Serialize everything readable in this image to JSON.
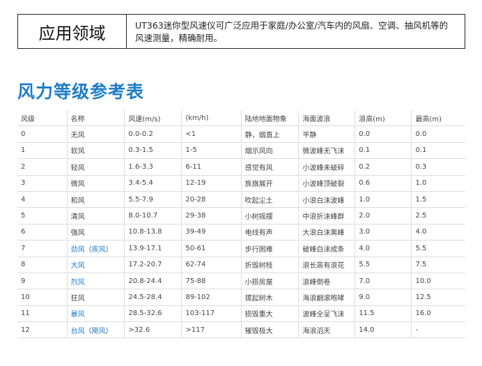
{
  "header": {
    "title": "应用领域",
    "description": "UT363迷你型风速仪可广泛应用于家庭/办公室/汽车内的风扇、空调、抽风机等的风速测量，精确耐用。"
  },
  "section_title": "风力等级参考表",
  "link_color": "#1f7dc8",
  "table": {
    "headers": [
      "风级",
      "名称",
      "风速(m/s)",
      "(km/h)",
      "陆地地面物象",
      "海面波浪",
      "浪高(m)",
      "最高(m)"
    ],
    "rows": [
      {
        "level": "0",
        "name_parts": [
          {
            "t": "无风",
            "link": false
          }
        ],
        "ms": "0.0-0.2",
        "kmh": "<1",
        "land": "静，烟直上",
        "sea": "平静",
        "wave": "0.0",
        "max": "0.0"
      },
      {
        "level": "1",
        "name_parts": [
          {
            "t": "软风",
            "link": false
          }
        ],
        "ms": "0.3-1.5",
        "kmh": "1-5",
        "land": "烟示风向",
        "sea": "微波峰无飞沫",
        "wave": "0.1",
        "max": "0.1"
      },
      {
        "level": "2",
        "name_parts": [
          {
            "t": "轻风",
            "link": false
          }
        ],
        "ms": "1.6-3.3",
        "kmh": "6-11",
        "land": "感觉有风",
        "sea": "小波峰未破碎",
        "wave": "0.2",
        "max": "0.3"
      },
      {
        "level": "3",
        "name_parts": [
          {
            "t": "微风",
            "link": false
          }
        ],
        "ms": "3.4-5.4",
        "kmh": "12-19",
        "land": "旌旗展开",
        "sea": "小波峰顶破裂",
        "wave": "0.6",
        "max": "1.0"
      },
      {
        "level": "4",
        "name_parts": [
          {
            "t": "和风",
            "link": false
          }
        ],
        "ms": "5.5-7.9",
        "kmh": "20-28",
        "land": "吹起尘土",
        "sea": "小浪白沫波峰",
        "wave": "1.0",
        "max": "1.5"
      },
      {
        "level": "5",
        "name_parts": [
          {
            "t": "清风",
            "link": false
          }
        ],
        "ms": "8.0-10.7",
        "kmh": "29-38",
        "land": "小树摇摆",
        "sea": "中浪折沫峰群",
        "wave": "2.0",
        "max": "2.5"
      },
      {
        "level": "6",
        "name_parts": [
          {
            "t": "强风",
            "link": false
          }
        ],
        "ms": "10.8-13.8",
        "kmh": "39-49",
        "land": "电线有声",
        "sea": "大浪白沫离峰",
        "wave": "3.0",
        "max": "4.0"
      },
      {
        "level": "7",
        "name_parts": [
          {
            "t": "劲风",
            "link": true
          },
          {
            "t": "（",
            "link": false
          },
          {
            "t": "疾风",
            "link": true
          },
          {
            "t": "）",
            "link": false
          }
        ],
        "ms": "13.9-17.1",
        "kmh": "50-61",
        "land": "步行困难",
        "sea": "破峰白沫成条",
        "wave": "4.0",
        "max": "5.5"
      },
      {
        "level": "8",
        "name_parts": [
          {
            "t": "大风",
            "link": true
          }
        ],
        "ms": "17.2-20.7",
        "kmh": "62-74",
        "land": "折毁树枝",
        "sea": "浪长高有浪花",
        "wave": "5.5",
        "max": "7.5"
      },
      {
        "level": "9",
        "name_parts": [
          {
            "t": "烈风",
            "link": true
          }
        ],
        "ms": "20.8-24.4",
        "kmh": "75-88",
        "land": "小损房屋",
        "sea": "浪峰倒卷",
        "wave": "7.0",
        "max": "10.0"
      },
      {
        "level": "10",
        "name_parts": [
          {
            "t": "狂风",
            "link": false
          }
        ],
        "ms": "24.5-28.4",
        "kmh": "89-102",
        "land": "拔起树木",
        "sea": "海浪翻滚咆哮",
        "wave": "9.0",
        "max": "12.5"
      },
      {
        "level": "11",
        "name_parts": [
          {
            "t": "暴风",
            "link": true
          }
        ],
        "ms": "28.5-32.6",
        "kmh": "103-117",
        "land": "损毁重大",
        "sea": "波峰全呈飞沫",
        "wave": "11.5",
        "max": "16.0"
      },
      {
        "level": "12",
        "name_parts": [
          {
            "t": "台风",
            "link": true
          },
          {
            "t": "（",
            "link": false
          },
          {
            "t": "飓风",
            "link": true
          },
          {
            "t": "）",
            "link": false
          }
        ],
        "ms": ">32.6",
        "kmh": ">117",
        "land": "摧毁极大",
        "sea": "海浪滔天",
        "wave": "14.0",
        "max": "-"
      }
    ]
  }
}
